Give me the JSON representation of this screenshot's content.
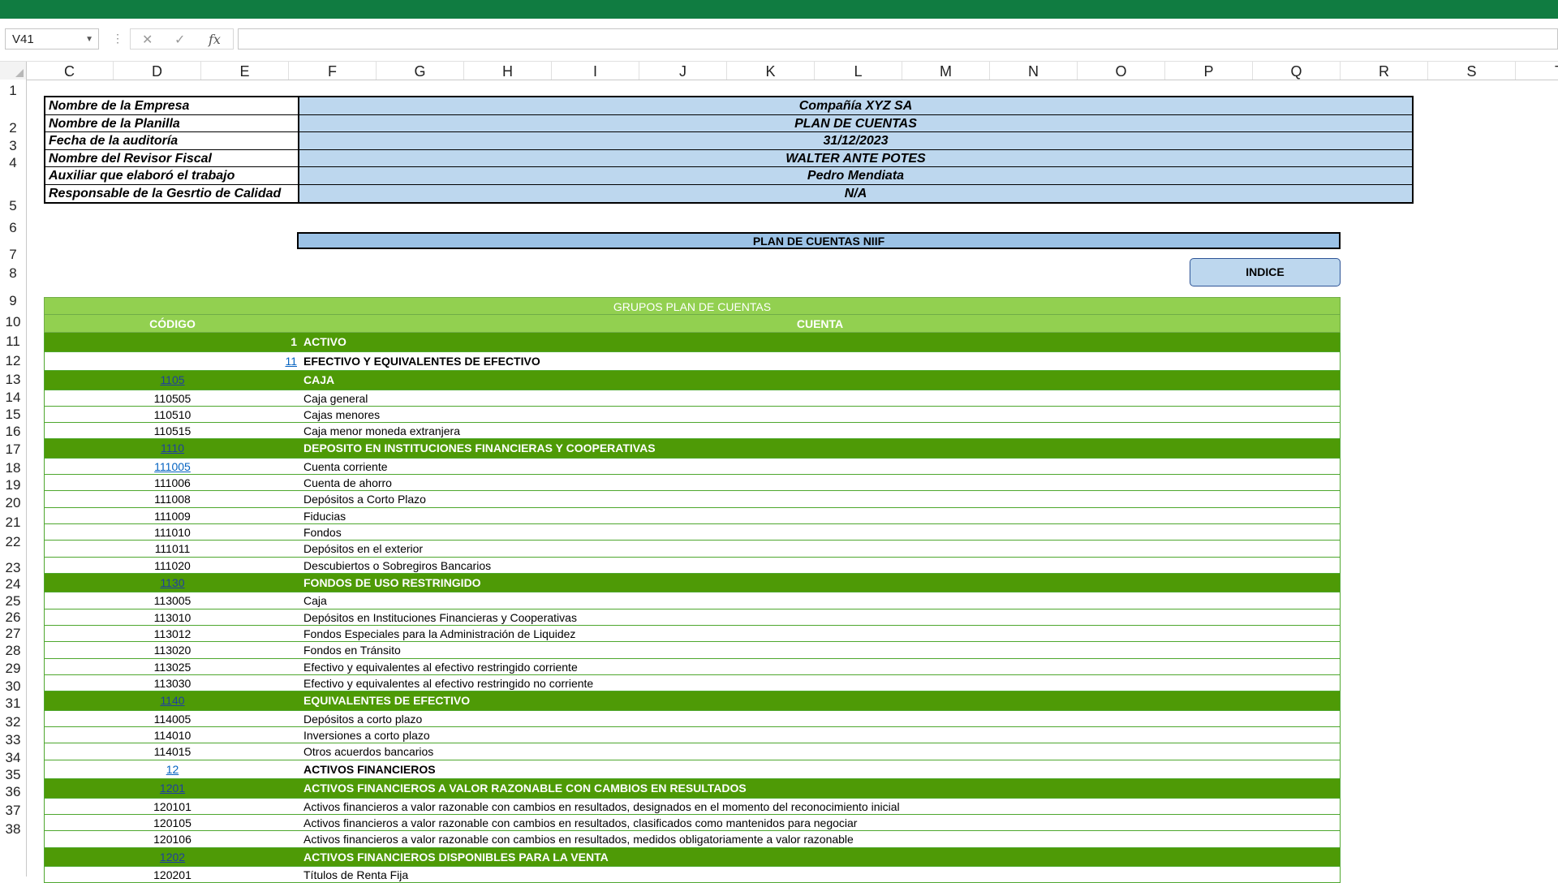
{
  "formula_bar": {
    "name_box": "V41",
    "formula": ""
  },
  "columns": [
    "C",
    "D",
    "E",
    "F",
    "G",
    "H",
    "I",
    "J",
    "K",
    "L",
    "M",
    "N",
    "O",
    "P",
    "Q",
    "R",
    "S",
    "T"
  ],
  "rows": [
    "1",
    "2",
    "3",
    "4",
    "5",
    "6",
    "7",
    "8",
    "9",
    "10",
    "11",
    "12",
    "13",
    "14",
    "15",
    "16",
    "17",
    "18",
    "19",
    "20",
    "21",
    "22",
    "23",
    "24",
    "25",
    "26",
    "27",
    "28",
    "29",
    "30",
    "31",
    "32",
    "33",
    "34",
    "35",
    "36",
    "37",
    "38"
  ],
  "info": [
    {
      "label": "Nombre de la Empresa",
      "value": "Compañía XYZ SA"
    },
    {
      "label": "Nombre de la Planilla",
      "value": "PLAN DE CUENTAS"
    },
    {
      "label": "Fecha de la auditoría",
      "value": "31/12/2023"
    },
    {
      "label": "Nombre del Revisor Fiscal",
      "value": "WALTER ANTE POTES"
    },
    {
      "label": "Auxiliar que elaboró el trabajo",
      "value": "Pedro Mendiata"
    },
    {
      "label": "Responsable de la Gesrtio de Calidad",
      "value": "N/A"
    }
  ],
  "banner": "PLAN DE CUENTAS NIIF",
  "indice_button": "INDICE",
  "table": {
    "group_title": "GRUPOS PLAN DE CUENTAS",
    "col_code": "CÓDIGO",
    "col_account": "CUENTA",
    "rows": [
      {
        "code": "1",
        "name": "ACTIVO",
        "style": "top",
        "link": false
      },
      {
        "code": "11",
        "name": "EFECTIVO Y EQUIVALENTES DE EFECTIVO",
        "style": "h2",
        "link": true
      },
      {
        "code": "1105",
        "name": "CAJA",
        "style": "h4",
        "link": true
      },
      {
        "code": "110505",
        "name": "Caja general",
        "style": "plain",
        "link": false
      },
      {
        "code": "110510",
        "name": "Cajas menores",
        "style": "plain",
        "link": false
      },
      {
        "code": "110515",
        "name": "Caja menor moneda extranjera",
        "style": "plain",
        "link": false
      },
      {
        "code": "1110",
        "name": "DEPOSITO EN INSTITUCIONES FINANCIERAS Y COOPERATIVAS",
        "style": "h4",
        "link": true
      },
      {
        "code": "111005",
        "name": "Cuenta corriente",
        "style": "plain",
        "link": true
      },
      {
        "code": "111006",
        "name": "Cuenta de ahorro",
        "style": "plain",
        "link": false
      },
      {
        "code": "111008",
        "name": "Depósitos a Corto Plazo",
        "style": "plain",
        "link": false
      },
      {
        "code": "111009",
        "name": "Fiducias",
        "style": "plain",
        "link": false
      },
      {
        "code": "111010",
        "name": "Fondos",
        "style": "plain",
        "link": false
      },
      {
        "code": "111011",
        "name": "Depósitos en el exterior",
        "style": "plain",
        "link": false
      },
      {
        "code": "111020",
        "name": "Descubiertos o Sobregiros Bancarios",
        "style": "plain",
        "link": false
      },
      {
        "code": "1130",
        "name": "FONDOS DE USO RESTRINGIDO",
        "style": "h4",
        "link": true
      },
      {
        "code": "113005",
        "name": "Caja",
        "style": "plain",
        "link": false
      },
      {
        "code": "113010",
        "name": "Depósitos en Instituciones Financieras y Cooperativas",
        "style": "plain",
        "link": false
      },
      {
        "code": "113012",
        "name": "Fondos Especiales para la Administración de Liquidez",
        "style": "plain",
        "link": false
      },
      {
        "code": "113020",
        "name": "Fondos en Tránsito",
        "style": "plain",
        "link": false
      },
      {
        "code": "113025",
        "name": "Efectivo y equivalentes al efectivo restringido corriente",
        "style": "plain",
        "link": false
      },
      {
        "code": "113030",
        "name": "Efectivo y equivalentes al efectivo restringido no corriente",
        "style": "plain",
        "link": false
      },
      {
        "code": "1140",
        "name": "EQUIVALENTES DE EFECTIVO",
        "style": "h4",
        "link": true
      },
      {
        "code": "114005",
        "name": "Depósitos a corto plazo",
        "style": "plain",
        "link": false
      },
      {
        "code": "114010",
        "name": "Inversiones a corto plazo",
        "style": "plain",
        "link": false
      },
      {
        "code": "114015",
        "name": "Otros acuerdos bancarios",
        "style": "plain",
        "link": false
      },
      {
        "code": "12",
        "name": "ACTIVOS FINANCIEROS",
        "style": "h2c",
        "link": true
      },
      {
        "code": "1201",
        "name": "ACTIVOS FINANCIEROS A VALOR RAZONABLE CON CAMBIOS EN RESULTADOS",
        "style": "h4",
        "link": true
      },
      {
        "code": "120101",
        "name": "Activos financieros a valor razonable con cambios en resultados, designados en el momento del reconocimiento inicial",
        "style": "plain",
        "link": false
      },
      {
        "code": "120105",
        "name": "Activos financieros a valor razonable con cambios en resultados, clasificados como mantenidos para negociar",
        "style": "plain",
        "link": false
      },
      {
        "code": "120106",
        "name": "Activos financieros a valor razonable con cambios en resultados, medidos obligatoriamente a valor razonable",
        "style": "plain",
        "link": false
      },
      {
        "code": "1202",
        "name": "ACTIVOS FINANCIEROS DISPONIBLES PARA LA VENTA",
        "style": "h4",
        "link": true
      },
      {
        "code": "120201",
        "name": "Títulos de Renta Fija",
        "style": "plain",
        "link": false
      }
    ]
  }
}
